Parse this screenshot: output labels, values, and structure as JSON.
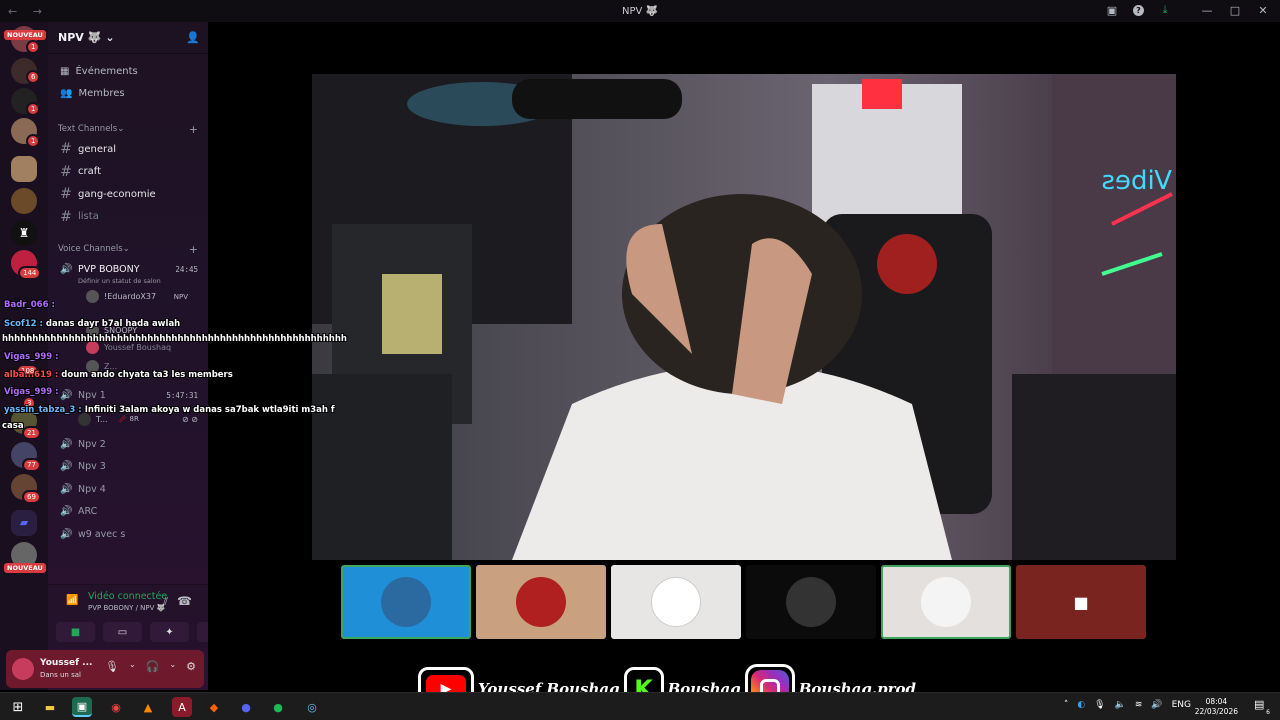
{
  "window": {
    "title": "NPV 🐺",
    "nav": "← →"
  },
  "guilds": {
    "nouveau_top": "NOUVEAU",
    "nouveau_bottom": "NOUVEAU",
    "badges": [
      "1",
      "6",
      "1",
      "1",
      "144",
      "108",
      "3",
      "21",
      "77",
      "69"
    ]
  },
  "server": {
    "name": "NPV 🐺",
    "chevron": "⌄"
  },
  "nav": {
    "events": "Événements",
    "members": "Membres"
  },
  "text_channels": {
    "label": "Text Channels",
    "items": [
      {
        "name": "general"
      },
      {
        "name": "craft"
      },
      {
        "name": "gang-economie"
      },
      {
        "name": "lista"
      }
    ]
  },
  "voice_channels": {
    "label": "Voice Channels",
    "active": {
      "name": "PVP BOBONY",
      "time": "24:45",
      "status": "Définir un statut de salon"
    },
    "users": [
      "!EduardoX37",
      "NPV",
      "SNOOPY",
      "Youssef Boushaq",
      "Z..."
    ],
    "npv1": {
      "name": "Npv 1",
      "time": "5:47:31",
      "user": "T...",
      "tag": "🥢 8R"
    },
    "others": [
      "Npv 2",
      "Npv 3",
      "Npv 4",
      "ARC",
      "w9 avec s"
    ]
  },
  "voice_panel": {
    "title": "Vidéo connectée",
    "subtitle": "PVP BOBONY / NPV 🐺"
  },
  "user_panel": {
    "name": "Youssef ...",
    "status": "Dans un sal"
  },
  "chat": [
    {
      "user": "Badr_066 :",
      "color": "#b36bff",
      "text": ""
    },
    {
      "user": "Scof12 :",
      "color": "#6bb8ff",
      "text": "danas dayr b7al hada awlah"
    },
    {
      "user": "",
      "color": "#fff",
      "text": "hhhhhhhhhhhhhhhhhhhhhhhhhhhhhhhhhhhhhhhhhhhhhhhhhhhhhhhhh"
    },
    {
      "user": "Vigas_999 :",
      "color": "#b36bff",
      "text": ""
    },
    {
      "user": "alba...619 :",
      "color": "#ff4d4d",
      "text": "doum ando chyata ta3 les members"
    },
    {
      "user": "Vigas_999 :",
      "color": "#b36bff",
      "text": ""
    },
    {
      "user": "yassin_tabza_3 :",
      "color": "#6bb8ff",
      "text": "Infiniti 3alam akoya w danas sa7bak wtla9iti m3ah f"
    },
    {
      "user": "",
      "color": "#fff",
      "text": "casa"
    }
  ],
  "branding": {
    "youtube": "Youssef Boushaq",
    "kick": "Boushaq",
    "instagram": "Boushaq.prod"
  },
  "taskbar": {
    "lang": "ENG",
    "time": "08:04",
    "date": "22/03/2026",
    "notif_count": "6"
  },
  "colors": {
    "accent_green": "#23a55a",
    "badge_red": "#d83c3e"
  }
}
